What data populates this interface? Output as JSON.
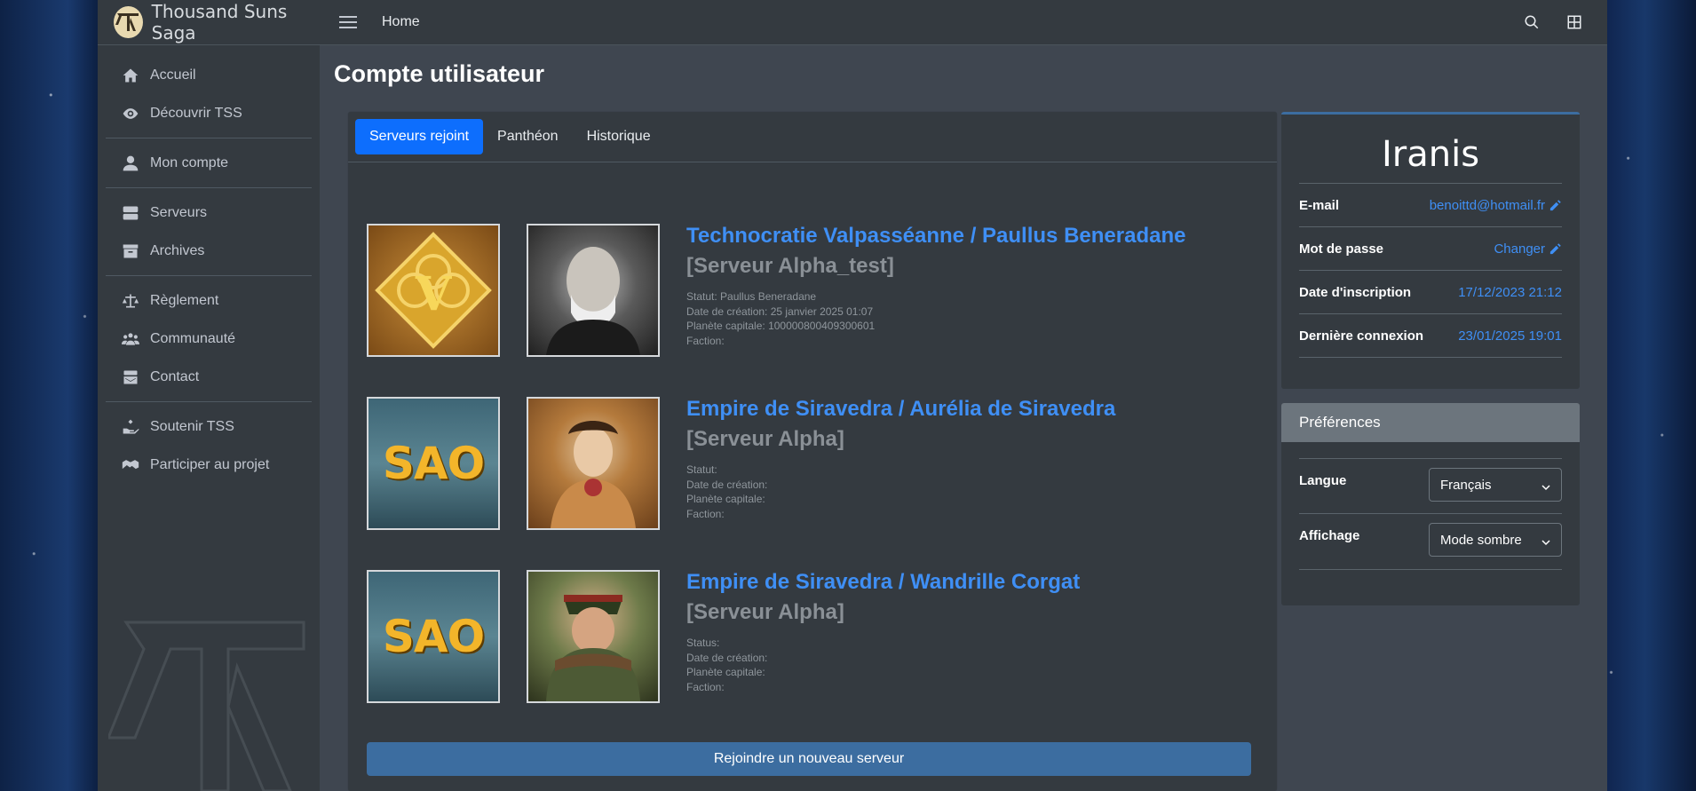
{
  "brand": {
    "name": "Thousand Suns Saga"
  },
  "sidebar": {
    "groups": [
      {
        "items": [
          {
            "label": "Accueil",
            "icon": "home-icon"
          },
          {
            "label": "Découvrir TSS",
            "icon": "eye-icon"
          }
        ]
      },
      {
        "items": [
          {
            "label": "Mon compte",
            "icon": "user-icon"
          }
        ]
      },
      {
        "items": [
          {
            "label": "Serveurs",
            "icon": "server-icon"
          },
          {
            "label": "Archives",
            "icon": "archive-icon"
          }
        ]
      },
      {
        "items": [
          {
            "label": "Règlement",
            "icon": "balance-scale-icon"
          },
          {
            "label": "Communauté",
            "icon": "users-icon"
          },
          {
            "label": "Contact",
            "icon": "mail-bulk-icon"
          }
        ]
      },
      {
        "items": [
          {
            "label": "Soutenir TSS",
            "icon": "hand-holding-icon"
          },
          {
            "label": "Participer au projet",
            "icon": "handshake-icon"
          }
        ]
      }
    ]
  },
  "topbar": {
    "home_label": "Home"
  },
  "page": {
    "title": "Compte utilisateur"
  },
  "tabs": [
    {
      "label": "Serveurs rejoint",
      "active": true
    },
    {
      "label": "Panthéon",
      "active": false
    },
    {
      "label": "Historique",
      "active": false
    }
  ],
  "servers": [
    {
      "title": "Technocratie Valpasséanne / Paullus Beneradane",
      "server": "[Serveur Alpha_test]",
      "meta": [
        "Statut: Paullus Beneradane",
        "Date de création: 25 janvier 2025 01:07",
        "Planète capitale: 100000800409300601",
        "Faction:"
      ],
      "emblem_text": "V"
    },
    {
      "title": "Empire de Siravedra / Aurélia de Siravedra",
      "server": "[Serveur Alpha]",
      "meta": [
        "Statut:",
        "Date de création:",
        "Planète capitale:",
        "Faction:"
      ],
      "emblem_text": "SAO"
    },
    {
      "title": "Empire de Siravedra / Wandrille Corgat",
      "server": "[Serveur Alpha]",
      "meta": [
        "Status:",
        "Date de création:",
        "Planète capitale:",
        "Faction:"
      ],
      "emblem_text": "SAO"
    }
  ],
  "join_button": "Rejoindre un nouveau serveur",
  "profile": {
    "name": "Iranis",
    "rows": [
      {
        "label": "E-mail",
        "value": "benoittd@hotmail.fr"
      },
      {
        "label": "Mot de passe",
        "value": "Changer"
      },
      {
        "label": "Date d'inscription",
        "value": "17/12/2023 21:12"
      },
      {
        "label": "Dernière connexion",
        "value": "23/01/2025 19:01"
      }
    ]
  },
  "preferences": {
    "title": "Préférences",
    "rows": [
      {
        "label": "Langue",
        "value": "Français"
      },
      {
        "label": "Affichage",
        "value": "Mode sombre"
      }
    ]
  },
  "colors": {
    "accent": "#0d6efd",
    "link": "#3f8ff5",
    "join": "#3c6da0"
  }
}
